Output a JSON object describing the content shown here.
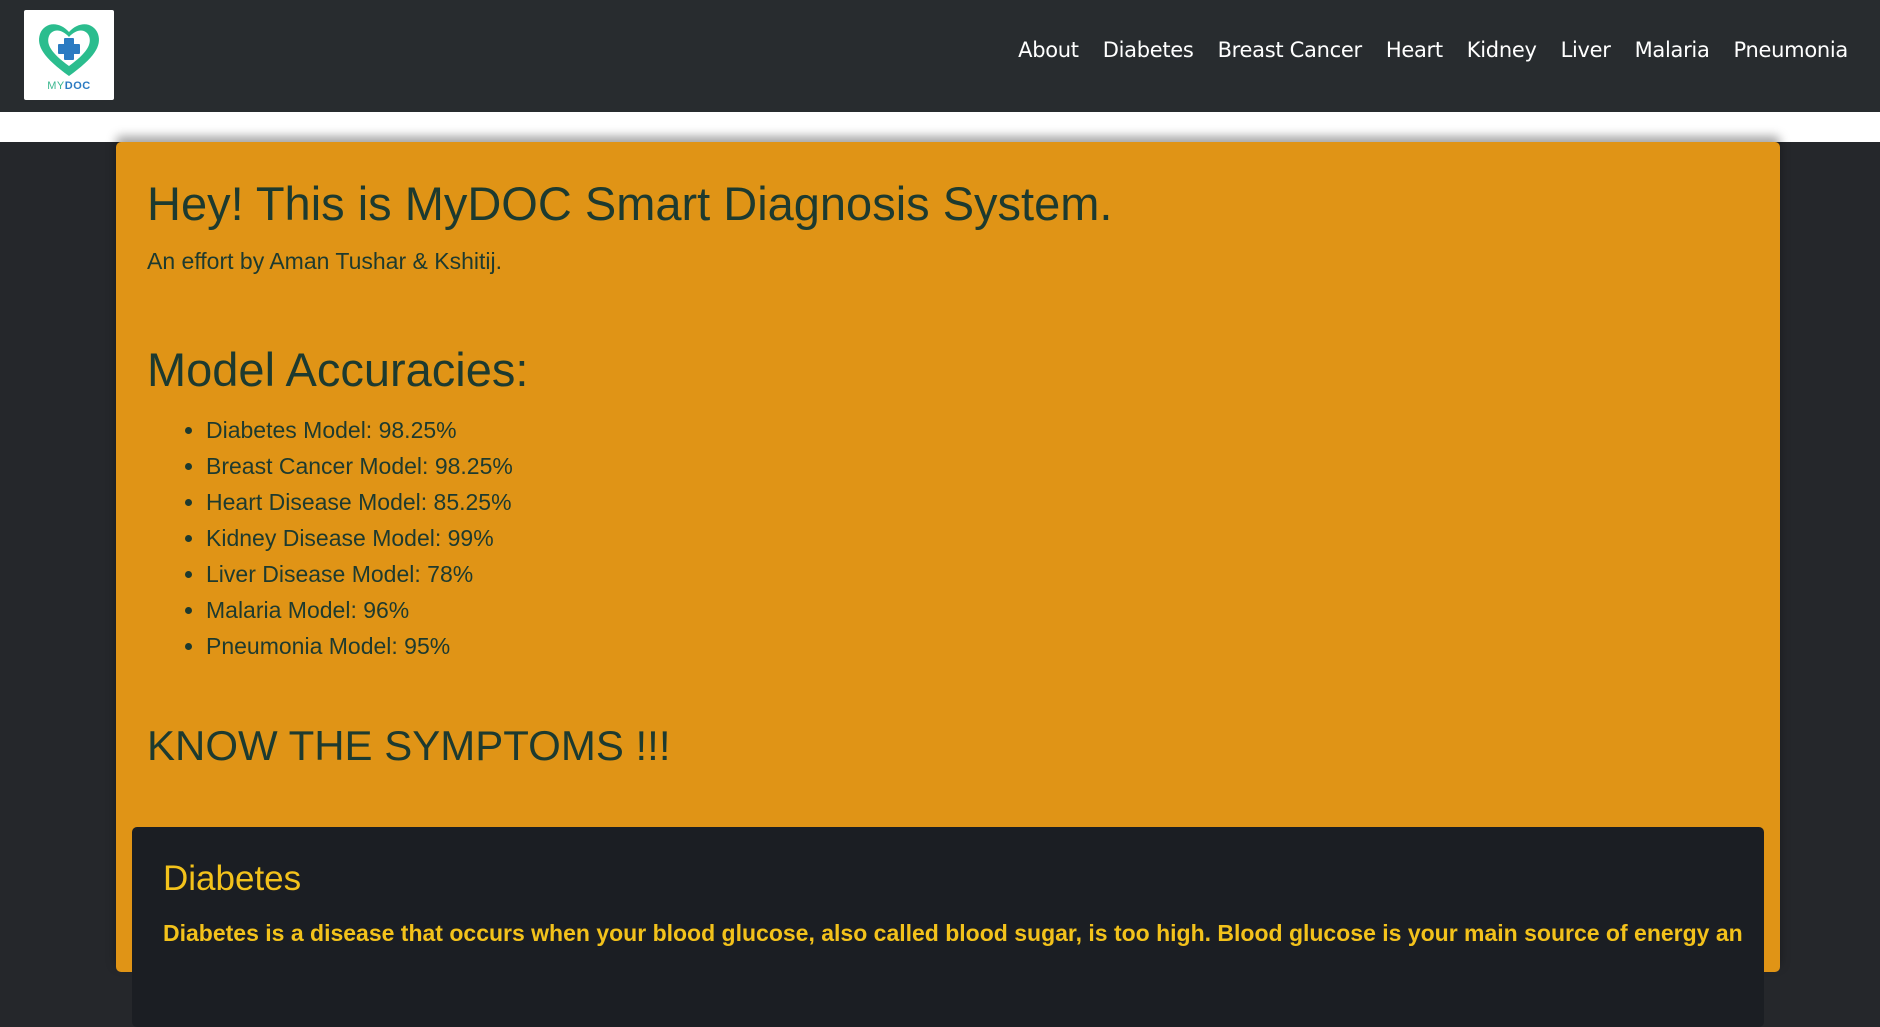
{
  "brand": {
    "logo_text_my": "MY",
    "logo_text_doc": "DOC"
  },
  "nav": {
    "links": [
      "About",
      "Diabetes",
      "Breast Cancer",
      "Heart",
      "Kidney",
      "Liver",
      "Malaria",
      "Pneumonia"
    ]
  },
  "hero": {
    "title": "Hey! This is MyDOC Smart Diagnosis System.",
    "subtitle": "An effort by Aman Tushar & Kshitij."
  },
  "accuracies": {
    "heading": "Model Accuracies:",
    "items": [
      "Diabetes Model: 98.25%",
      "Breast Cancer Model: 98.25%",
      "Heart Disease Model: 85.25%",
      "Kidney Disease Model: 99%",
      "Liver Disease Model: 78%",
      "Malaria Model: 96%",
      "Pneumonia Model: 95%"
    ]
  },
  "symptoms": {
    "heading": "KNOW THE SYMPTOMS !!!",
    "cards": [
      {
        "title": "Diabetes",
        "text": "Diabetes is a disease that occurs when your blood glucose, also called blood sugar, is too high. Blood glucose is your main source of energy and"
      }
    ]
  },
  "colors": {
    "navbar_bg": "#282c2f",
    "card_bg": "#e09416",
    "text_dark": "#1d3a2f",
    "inner_card_bg": "#1b1e23",
    "inner_text": "#f3c21b"
  }
}
